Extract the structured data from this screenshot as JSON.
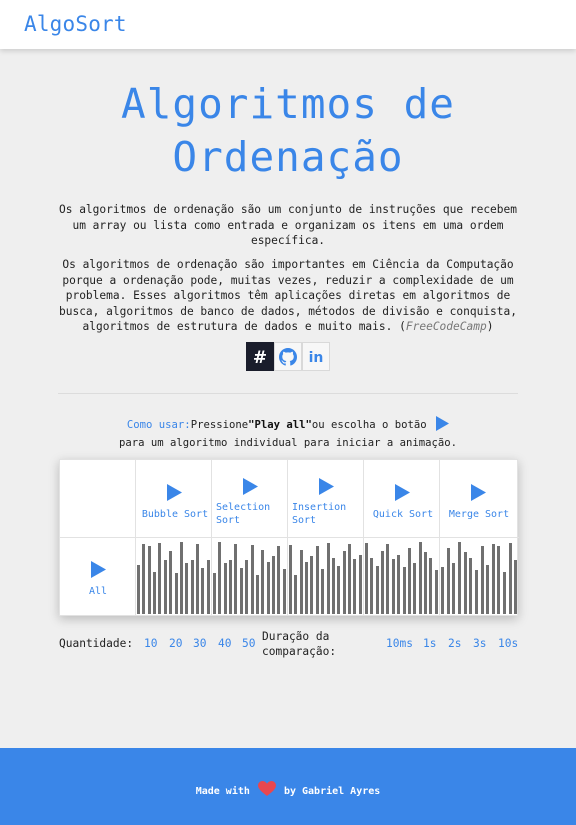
{
  "navbar": {
    "brand": "AlgoSort"
  },
  "hero": {
    "title_line1": "Algoritmos de",
    "title_line2": "Ordenação",
    "para1": "Os algoritmos de ordenação são um conjunto de instruções que recebem um array ou lista como entrada e organizam os itens em uma ordem específica.",
    "para2": "Os algoritmos de ordenação são importantes em Ciência da Computação porque a ordenação pode, muitas vezes, reduzir a complexidade de um problema. Esses algoritmos têm aplicações diretas em algoritmos de busca, algoritmos de banco de dados, métodos de divisão e conquista, algoritmos de estrutura de dados e muito mais.",
    "para2_source_open": " (",
    "para2_source": "FreeCodeCamp",
    "para2_source_close": ")"
  },
  "social": [
    {
      "icon": "hash-icon"
    },
    {
      "icon": "github-icon"
    },
    {
      "icon": "linkedin-icon"
    }
  ],
  "social_glyphs": {
    "hash": "#",
    "linkedin": "in"
  },
  "howto": {
    "label": "Como usar:",
    "text1": "Pressione",
    "play_all": "\"Play all\"",
    "text2": "ou escolha o botão",
    "text3": "para um algoritmo individual para iniciar a animação."
  },
  "panel": {
    "algorithms": [
      {
        "label": "Bubble Sort"
      },
      {
        "label": "Selection Sort"
      },
      {
        "label": "Insertion Sort"
      },
      {
        "label": "Quick Sort"
      },
      {
        "label": "Merge Sort"
      }
    ],
    "all_label": "All",
    "bar_values": [
      50,
      72,
      70,
      43,
      73,
      55,
      65,
      42,
      74,
      52,
      55,
      72,
      47,
      55,
      71,
      40,
      66,
      53,
      60,
      70,
      46,
      73,
      58,
      49,
      65,
      72,
      56,
      61,
      48,
      68,
      52,
      74,
      64,
      57,
      45,
      70
    ],
    "bar_color": "#707070"
  },
  "controls": {
    "quantity_label": "Quantidade:",
    "quantities": [
      "10",
      "20",
      "30",
      "40",
      "50"
    ],
    "duration_label_1": "Duração da",
    "duration_label_2": "comparação:",
    "durations": [
      "10ms",
      "1s",
      "2s",
      "3s",
      "10s"
    ]
  },
  "footer": {
    "made_with": "Made with",
    "by": "by Gabriel Ayres"
  },
  "colors": {
    "accent": "#3a86e8",
    "background": "#efefef",
    "heart": "#e8474f"
  }
}
